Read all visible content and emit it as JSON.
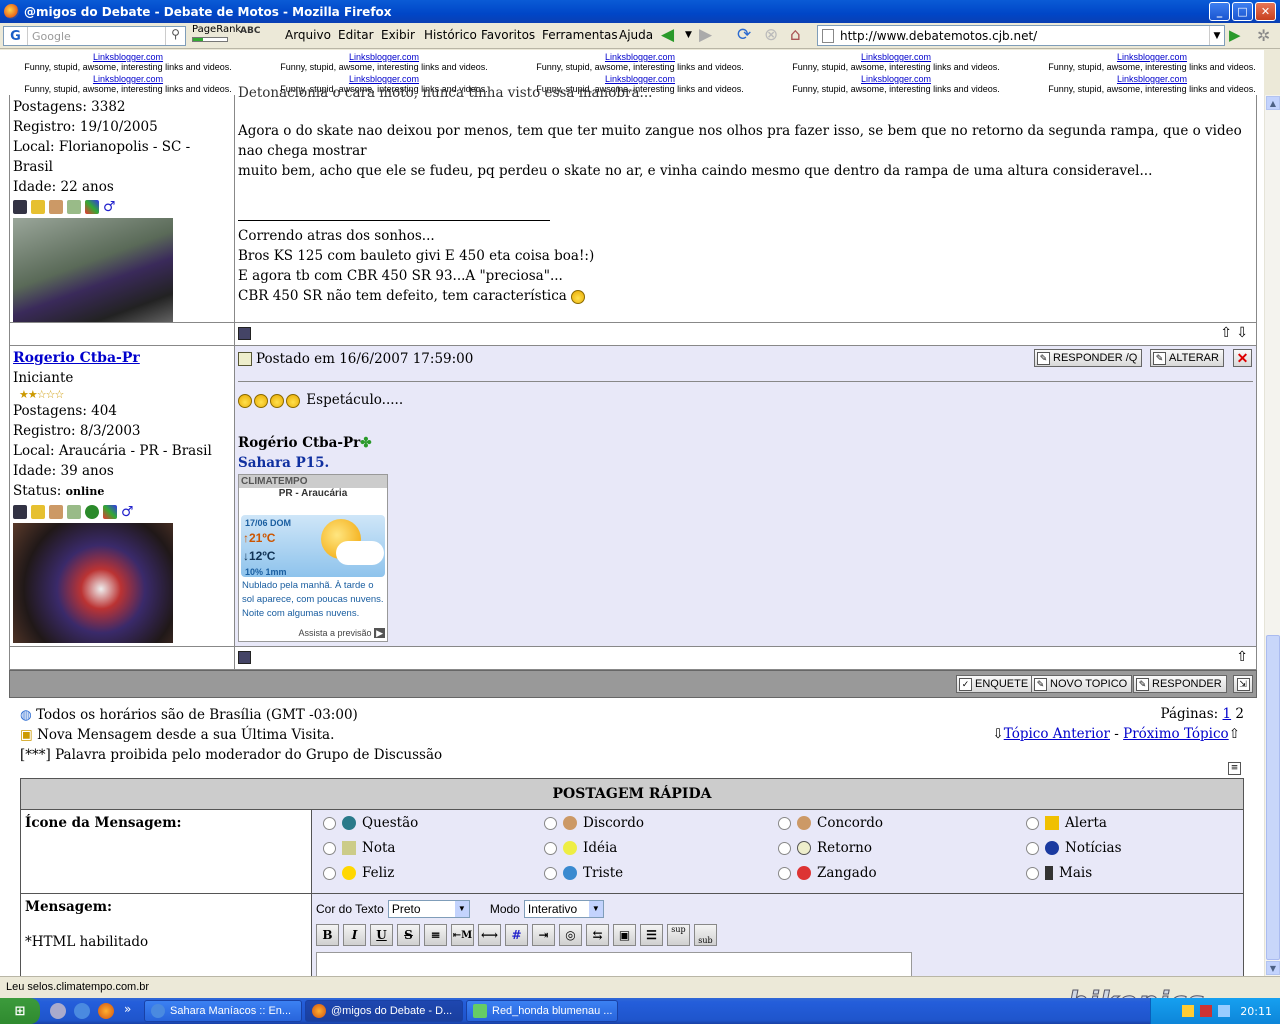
{
  "window": {
    "title": "@migos do Debate - Debate de Motos - Mozilla Firefox",
    "min": "_",
    "max": "□",
    "close": "✕"
  },
  "toolbar": {
    "google_logo": "G",
    "google_placeholder": "Google",
    "pagerank": "PageRank",
    "spell": "ABC",
    "menu": [
      "Arquivo",
      "Editar",
      "Exibir",
      "Histórico",
      "Favoritos",
      "Ferramentas",
      "Ajuda"
    ],
    "url": "http://www.debatemotos.cjb.net/"
  },
  "ads": {
    "title": "Linksblogger.com",
    "desc": "Funny, stupid, awsome, interesting links and videos."
  },
  "post1": {
    "partial_top": "Detonacionia o cara moto, nunca tinha visto essa manobra...",
    "left": [
      "Postagens: 3382",
      "Registro: 19/10/2005",
      "Local: Florianopolis - SC - Brasil",
      "Idade: 22 anos"
    ],
    "body": [
      "Agora o do skate nao deixou por menos, tem que ter muito zangue nos olhos pra fazer isso, se bem que no retorno da segunda rampa, que o video nao chega mostrar",
      "muito bem, acho que ele se fudeu, pq perdeu o skate no ar, e vinha caindo mesmo que dentro da rampa de uma altura consideravel..."
    ],
    "signature": [
      "Correndo atras dos sonhos...",
      "Bros KS 125 com bauleto givi E 450 eta coisa boa!:)",
      "E agora tb com CBR 450 SR 93...A \"preciosa\"...",
      "CBR 450 SR não tem defeito, tem característica"
    ]
  },
  "post2": {
    "author": "Rogerio Ctba-Pr",
    "rank": "Iniciante",
    "stats": [
      "Postagens: 404",
      "Registro: 8/3/2003",
      "Local: Araucária - PR - Brasil",
      "Idade: 39 anos"
    ],
    "status_label": "Status:",
    "status_value": "online",
    "posted": "Postado em 16/6/2007 17:59:00",
    "reply_quote": "RESPONDER /Q",
    "edit": "ALTERAR",
    "message": "Espetáculo.....",
    "sig_name": "Rogério Ctba-Pr",
    "sig_bike": "Sahara P15.",
    "weather": {
      "brand": "CLIMATEMPO",
      "city": "PR - Araucária",
      "date": "17/06 DOM",
      "max": "21ºC",
      "min": "12ºC",
      "rain": "10%  1mm",
      "text": "Nublado pela manhã. À tarde o sol aparece, com poucas nuvens. Noite com algumas nuvens.",
      "more": "Assista a previsão"
    }
  },
  "actions": {
    "poll": "ENQUETE",
    "new_topic": "NOVO TOPICO",
    "reply": "RESPONDER"
  },
  "info": {
    "timezone": "Todos os horários são de Brasília (GMT -03:00)",
    "new_msg": "Nova Mensagem desde a sua Última Visita.",
    "forbidden": "[***] Palavra proibida pelo moderador do Grupo de Discussão",
    "pages_label": "Páginas:",
    "page1": "1",
    "page2": "2",
    "prev_topic": "Tópico Anterior",
    "sep": "-",
    "next_topic": "Próximo Tópico"
  },
  "quickpost": {
    "header": "POSTAGEM RÁPIDA",
    "icon_label": "Ícone da Mensagem:",
    "icons": [
      [
        "Questão",
        "Discordo",
        "Concordo",
        "Alerta"
      ],
      [
        "Nota",
        "Idéia",
        "Retorno",
        "Notícias"
      ],
      [
        "Feliz",
        "Triste",
        "Zangado",
        "Mais"
      ]
    ],
    "msg_label": "Mensagem:",
    "html_note": "*HTML habilitado",
    "color_label": "Cor do Texto",
    "color_value": "Preto",
    "mode_label": "Modo",
    "mode_value": "Interativo",
    "editor": [
      "B",
      "I",
      "U",
      "S",
      "≡",
      "⇤M",
      "⟷",
      "#",
      "⇥",
      "◎",
      "⇆",
      "▣",
      "☰",
      "sup",
      "sub"
    ]
  },
  "status_bar": "Leu selos.climatempo.com.br",
  "taskbar": {
    "start": "⊞",
    "tasks": [
      "Sahara Maníacos :: En...",
      "@migos do Debate - D...",
      "Red_honda blumenau ..."
    ],
    "more": "»",
    "clock": "20:11"
  },
  "watermark": "bikepics"
}
